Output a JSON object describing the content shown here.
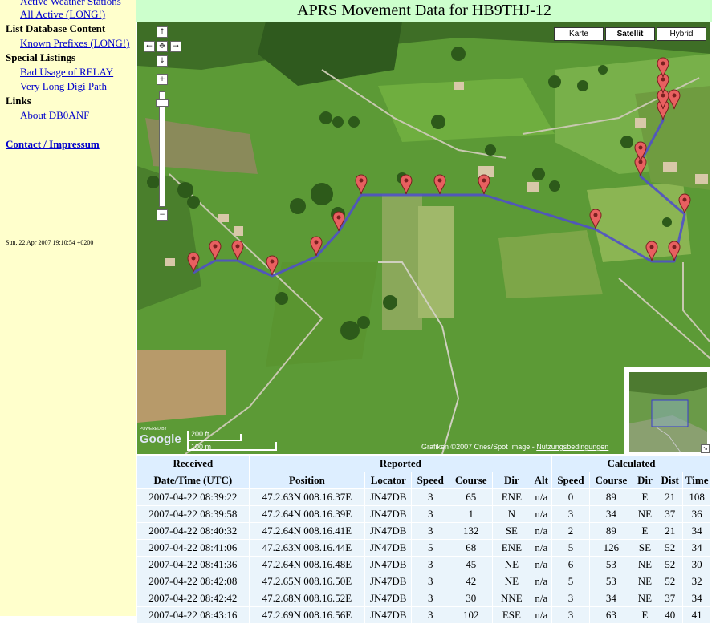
{
  "sidebar": {
    "items_top": [
      {
        "label": "Active Weather Stations"
      },
      {
        "label": "All Active (LONG!)"
      }
    ],
    "sections": [
      {
        "title": "List Database Content",
        "links": [
          "Known Prefixes (LONG!)"
        ]
      },
      {
        "title": "Special Listings",
        "links": [
          "Bad Usage of RELAY",
          "Very Long Digi Path"
        ]
      },
      {
        "title": "Links",
        "links": [
          "About DB0ANF"
        ]
      }
    ],
    "contact": "Contact / Impressum",
    "timestamp": "Sun, 22 Apr 2007 19:10:54 +0200"
  },
  "page_title": "APRS Movement Data for HB9THJ-12",
  "map": {
    "types": [
      "Karte",
      "Satellit",
      "Hybrid"
    ],
    "active_type": "Satellit",
    "pan": {
      "up": "↑",
      "left": "←",
      "center": "✥",
      "right": "→",
      "down": "↓"
    },
    "zoom_in": "+",
    "zoom_out": "−",
    "scale_ft": "200 ft",
    "scale_m": "100 m",
    "powered_by": "POWERED BY",
    "logo": "Google",
    "copyright": "Grafiken ©2007 Cnes/Spot Image - ",
    "terms": "Nutzungsbedingungen",
    "overview_toggle": "↘",
    "colors": {
      "track": "#5050c8",
      "marker": "#e86060",
      "grass": "#5c9a36"
    }
  },
  "table": {
    "group_headers": [
      "Received",
      "Reported",
      "Calculated"
    ],
    "columns": [
      "Date/Time (UTC)",
      "Position",
      "Locator",
      "Speed",
      "Course",
      "Dir",
      "Alt",
      "Speed",
      "Course",
      "Dir",
      "Dist",
      "Time"
    ],
    "rows": [
      [
        "2007-04-22 08:39:22",
        "47.2.63N 008.16.37E",
        "JN47DB",
        "3",
        "65",
        "ENE",
        "n/a",
        "0",
        "89",
        "E",
        "21",
        "108"
      ],
      [
        "2007-04-22 08:39:58",
        "47.2.64N 008.16.39E",
        "JN47DB",
        "3",
        "1",
        "N",
        "n/a",
        "3",
        "34",
        "NE",
        "37",
        "36"
      ],
      [
        "2007-04-22 08:40:32",
        "47.2.64N 008.16.41E",
        "JN47DB",
        "3",
        "132",
        "SE",
        "n/a",
        "2",
        "89",
        "E",
        "21",
        "34"
      ],
      [
        "2007-04-22 08:41:06",
        "47.2.63N 008.16.44E",
        "JN47DB",
        "5",
        "68",
        "ENE",
        "n/a",
        "5",
        "126",
        "SE",
        "52",
        "34"
      ],
      [
        "2007-04-22 08:41:36",
        "47.2.64N 008.16.48E",
        "JN47DB",
        "3",
        "45",
        "NE",
        "n/a",
        "6",
        "53",
        "NE",
        "52",
        "30"
      ],
      [
        "2007-04-22 08:42:08",
        "47.2.65N 008.16.50E",
        "JN47DB",
        "3",
        "42",
        "NE",
        "n/a",
        "5",
        "53",
        "NE",
        "52",
        "32"
      ],
      [
        "2007-04-22 08:42:42",
        "47.2.68N 008.16.52E",
        "JN47DB",
        "3",
        "30",
        "NNE",
        "n/a",
        "3",
        "34",
        "NE",
        "37",
        "34"
      ],
      [
        "2007-04-22 08:43:16",
        "47.2.69N 008.16.56E",
        "JN47DB",
        "3",
        "102",
        "ESE",
        "n/a",
        "3",
        "63",
        "E",
        "40",
        "41"
      ]
    ]
  }
}
